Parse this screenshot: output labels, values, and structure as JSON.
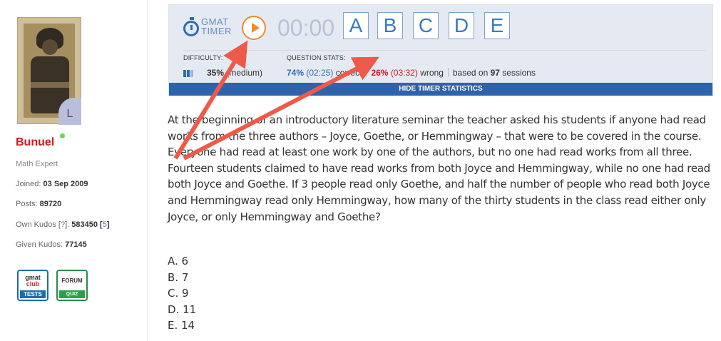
{
  "sidebar": {
    "username": "Bunuel",
    "level": "L",
    "role": "Math Expert",
    "joined_label": "Joined: ",
    "joined_value": "03 Sep 2009",
    "posts_label": "Posts: ",
    "posts_value": "89720",
    "own_kudos_label": "Own Kudos [",
    "own_kudos_help": "?",
    "own_kudos_sep": "]: ",
    "own_kudos_value": "583450",
    "own_kudos_bracket_open": " [",
    "own_kudos_extra": "5",
    "own_kudos_bracket_close": "]",
    "given_kudos_label": "Given Kudos: ",
    "given_kudos_value": "77145",
    "badge_tests_top": "gmat",
    "badge_tests_mid": "club",
    "badge_tests_bottom": "TESTS",
    "badge_forum_top": "FORUM",
    "badge_forum_bottom": "QUIZ"
  },
  "timer": {
    "logo_line1": "GMAT",
    "logo_line2": "TIMER",
    "time": "00:00",
    "answers": [
      "A",
      "B",
      "C",
      "D",
      "E"
    ],
    "difficulty_label": "DIFFICULTY:",
    "difficulty_value": "35%",
    "difficulty_level": "(medium)",
    "stats_label": "QUESTION STATS:",
    "correct_pct": "74%",
    "correct_time": "(02:25)",
    "correct_word": "correct",
    "wrong_pct": "26%",
    "wrong_time": "(03:32)",
    "wrong_word": "wrong",
    "based_on": "based on ",
    "sessions_count": "97",
    "sessions_word": " sessions",
    "hide_label": "HIDE TIMER STATISTICS"
  },
  "question": {
    "text": "At the beginning of an introductory literature seminar the teacher asked his students if anyone had read works from the three authors – Joyce, Goethe, or Hemmingway – that were to be covered in the course. Everyone had read at least one work by one of the authors, but no one had read works from all three. Fourteen students claimed to have read works from both Joyce and Hemmingway, while no one had read both Joyce and Goethe. If 3 people read only Goethe, and half the number of people who read both Joyce and Hemmingway read only Hemmingway, how many of the thirty students in the class read either only Joyce, or only Hemmingway and Goethe?",
    "choices": [
      "A. 6",
      "B. 7",
      "C. 9",
      "D. 11",
      "E. 14"
    ]
  },
  "colors": {
    "accent_blue": "#2d6db3",
    "play_orange": "#f08a2a",
    "username_red": "#d9151a",
    "annotation_arrow": "#ee5a4a"
  }
}
